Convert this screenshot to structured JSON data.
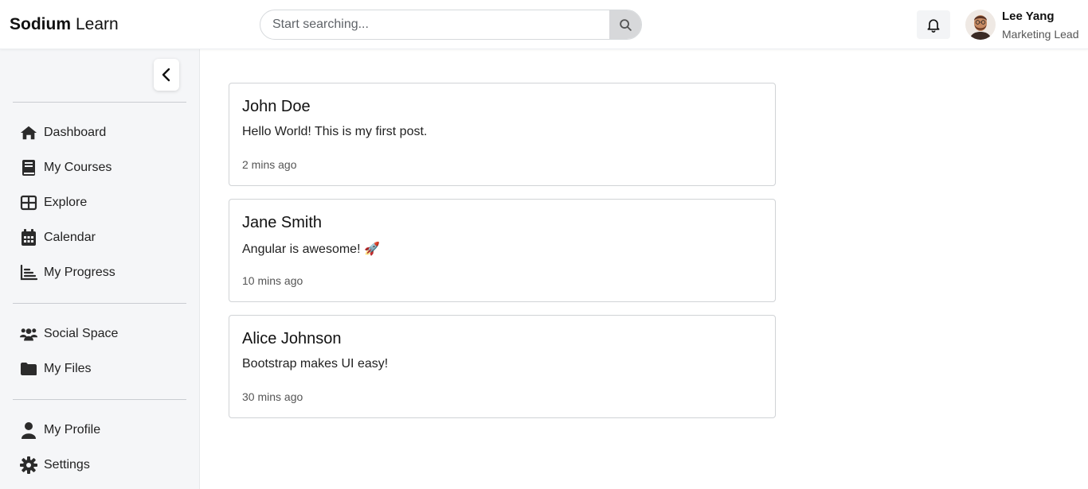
{
  "header": {
    "brand_bold": "Sodium",
    "brand_light": "Learn",
    "search_placeholder": "Start searching...",
    "user": {
      "name": "Lee Yang",
      "role": "Marketing Lead"
    }
  },
  "sidebar": {
    "groups": [
      [
        {
          "label": "Dashboard",
          "icon": "home-icon"
        },
        {
          "label": "My Courses",
          "icon": "book-icon"
        },
        {
          "label": "Explore",
          "icon": "grid-icon"
        },
        {
          "label": "Calendar",
          "icon": "calendar-icon"
        },
        {
          "label": "My Progress",
          "icon": "bar-chart-icon"
        }
      ],
      [
        {
          "label": "Social Space",
          "icon": "users-icon"
        },
        {
          "label": "My Files",
          "icon": "folder-icon"
        }
      ],
      [
        {
          "label": "My Profile",
          "icon": "user-icon"
        },
        {
          "label": "Settings",
          "icon": "gear-icon"
        }
      ]
    ]
  },
  "posts": [
    {
      "author": "John Doe",
      "content": "Hello World! This is my first post.",
      "time": "2 mins ago"
    },
    {
      "author": "Jane Smith",
      "content": "Angular is awesome! 🚀",
      "time": "10 mins ago"
    },
    {
      "author": "Alice Johnson",
      "content": "Bootstrap makes UI easy!",
      "time": "30 mins ago"
    }
  ]
}
